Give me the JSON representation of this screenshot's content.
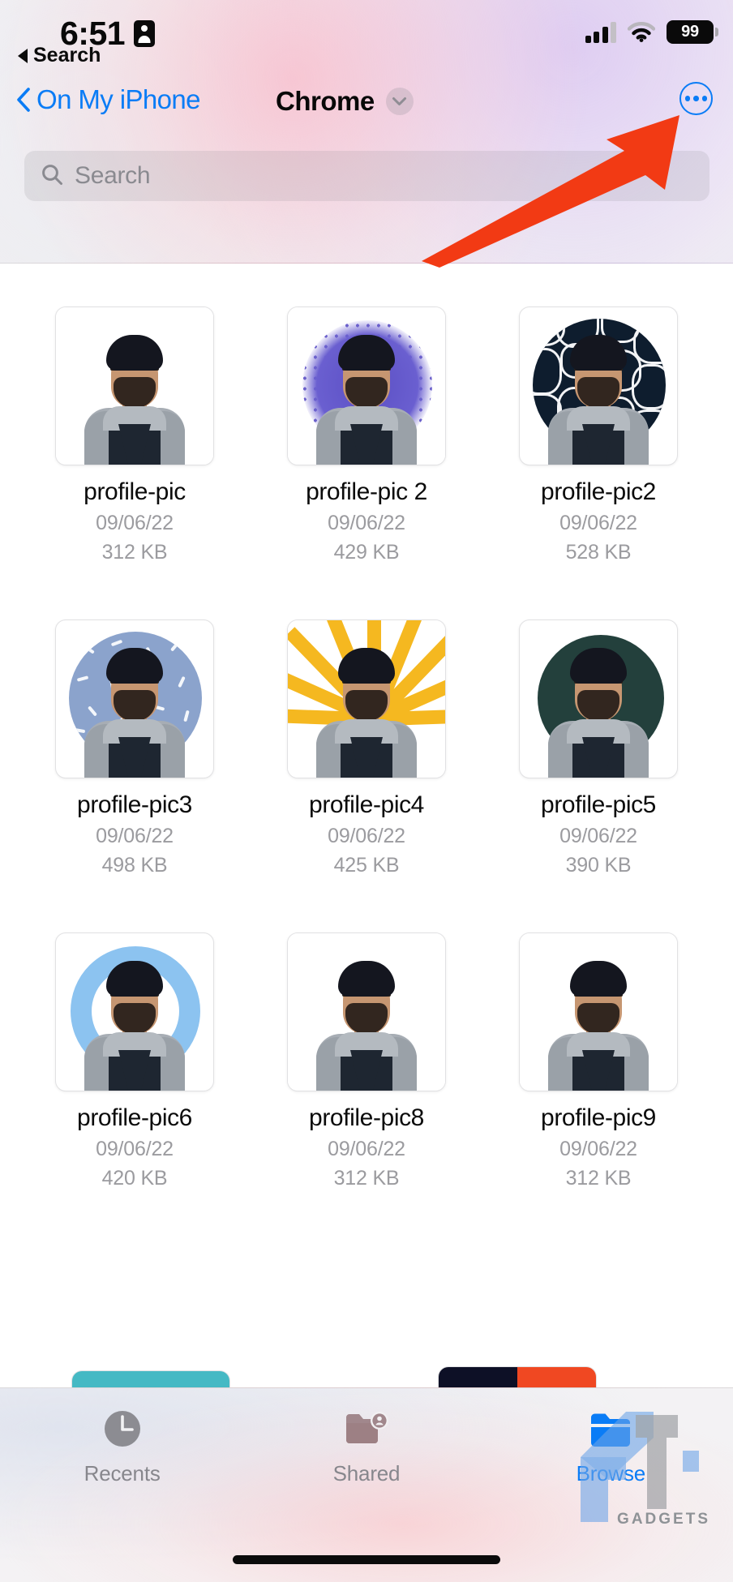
{
  "status_bar": {
    "time": "6:51",
    "id_badge_icon": "id-badge-icon",
    "signal_icon": "cellular-signal-icon",
    "wifi_icon": "wifi-icon",
    "battery_level": "99",
    "back_to_app_label": "Search",
    "back_to_app_icon": "back-triangle-icon"
  },
  "nav_bar": {
    "back_label": "On My iPhone",
    "back_icon": "chevron-left-icon",
    "title": "Chrome",
    "title_menu_icon": "chevron-down-icon",
    "more_options_icon": "ellipsis-circle-icon"
  },
  "search": {
    "placeholder": "Search",
    "icon": "search-icon",
    "value": ""
  },
  "files": [
    {
      "name": "profile-pic",
      "date": "09/06/22",
      "size": "312 KB",
      "art": "plain"
    },
    {
      "name": "profile-pic 2",
      "date": "09/06/22",
      "size": "429 KB",
      "art": "halftone"
    },
    {
      "name": "profile-pic2",
      "date": "09/06/22",
      "size": "528 KB",
      "art": "maze"
    },
    {
      "name": "profile-pic3",
      "date": "09/06/22",
      "size": "498 KB",
      "art": "confetti"
    },
    {
      "name": "profile-pic4",
      "date": "09/06/22",
      "size": "425 KB",
      "art": "sunburst"
    },
    {
      "name": "profile-pic5",
      "date": "09/06/22",
      "size": "390 KB",
      "art": "darkcircle"
    },
    {
      "name": "profile-pic6",
      "date": "09/06/22",
      "size": "420 KB",
      "art": "ring"
    },
    {
      "name": "profile-pic8",
      "date": "09/06/22",
      "size": "312 KB",
      "art": "plain"
    },
    {
      "name": "profile-pic9",
      "date": "09/06/22",
      "size": "312 KB",
      "art": "plain"
    }
  ],
  "tab_bar": {
    "tabs": [
      {
        "label": "Recents",
        "icon": "clock-icon",
        "active": false
      },
      {
        "label": "Shared",
        "icon": "folder-person-icon",
        "active": false
      },
      {
        "label": "Browse",
        "icon": "folder-icon",
        "active": true
      }
    ]
  },
  "annotation": {
    "arrow_icon": "red-arrow-icon",
    "arrow_color": "#F23A14"
  },
  "watermark": {
    "logo_icon": "gt-logo-icon",
    "text": "GADGETS"
  },
  "colors": {
    "accent_blue": "#0A7CF6",
    "inactive_gray": "#87878D",
    "metadata_gray": "#9B9B9F",
    "annotation_red": "#F23A14"
  }
}
